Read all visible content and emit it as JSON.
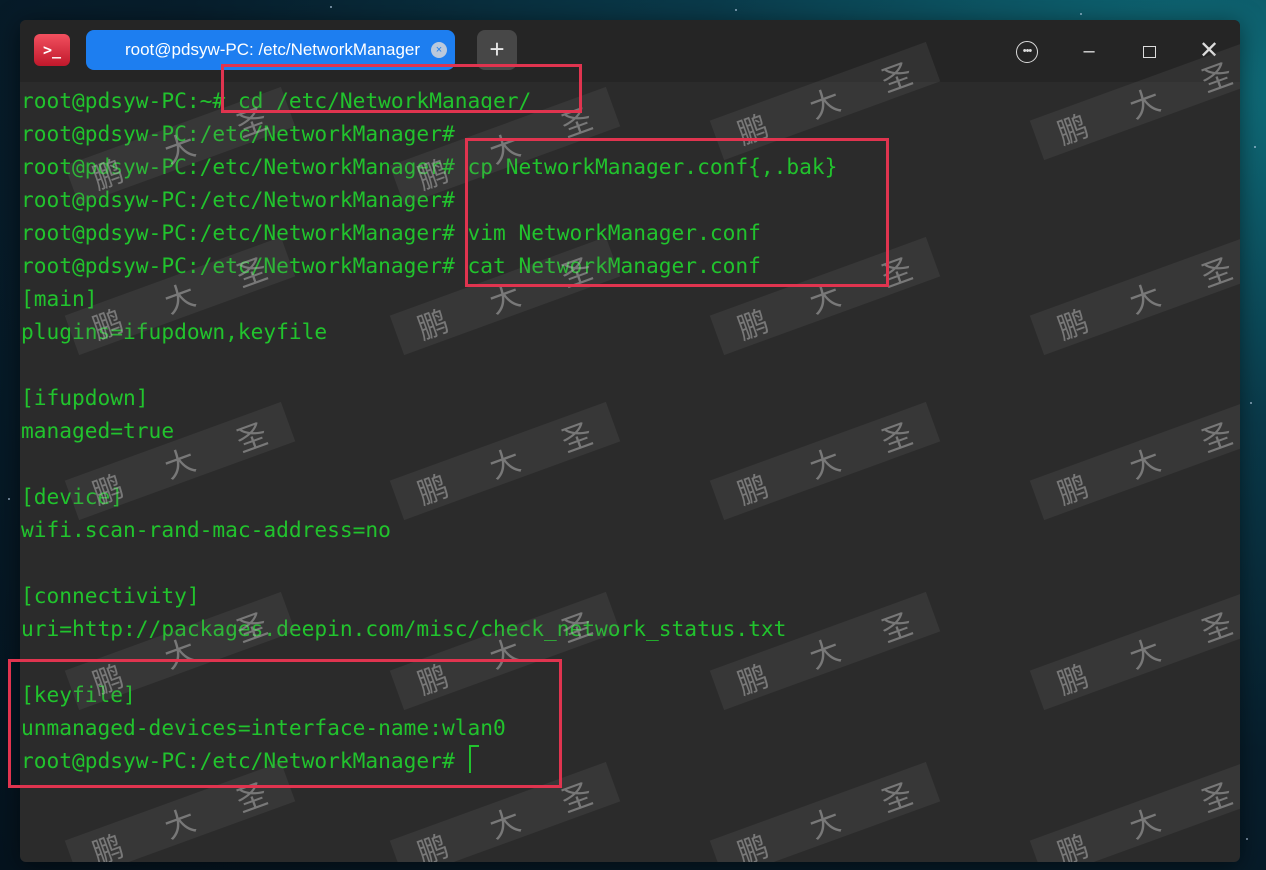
{
  "app": {
    "icon_text": ">_"
  },
  "tab": {
    "title": "root@pdsyw-PC: /etc/NetworkManager",
    "close_glyph": "×"
  },
  "window_controls": {
    "new_tab": "+",
    "menu": "•••",
    "minimize": "–",
    "close": "✕"
  },
  "terminal": {
    "lines": [
      "root@pdsyw-PC:~# cd /etc/NetworkManager/",
      "root@pdsyw-PC:/etc/NetworkManager#",
      "root@pdsyw-PC:/etc/NetworkManager# cp NetworkManager.conf{,.bak}",
      "root@pdsyw-PC:/etc/NetworkManager#",
      "root@pdsyw-PC:/etc/NetworkManager# vim NetworkManager.conf",
      "root@pdsyw-PC:/etc/NetworkManager# cat NetworkManager.conf",
      "[main]",
      "plugins=ifupdown,keyfile",
      "",
      "[ifupdown]",
      "managed=true",
      "",
      "[device]",
      "wifi.scan-rand-mac-address=no",
      "",
      "[connectivity]",
      "uri=http://packages.deepin.com/misc/check_network_status.txt",
      "",
      "[keyfile]",
      "unmanaged-devices=interface-name:wlan0",
      "root@pdsyw-PC:/etc/NetworkManager# "
    ]
  },
  "watermark": {
    "text": [
      "鹏",
      "大",
      "圣"
    ]
  },
  "colors": {
    "terminal_text": "#21c32d",
    "terminal_bg": "#2b2b2b",
    "tab_active": "#1d7ef0",
    "highlight_box": "#e0344f"
  }
}
